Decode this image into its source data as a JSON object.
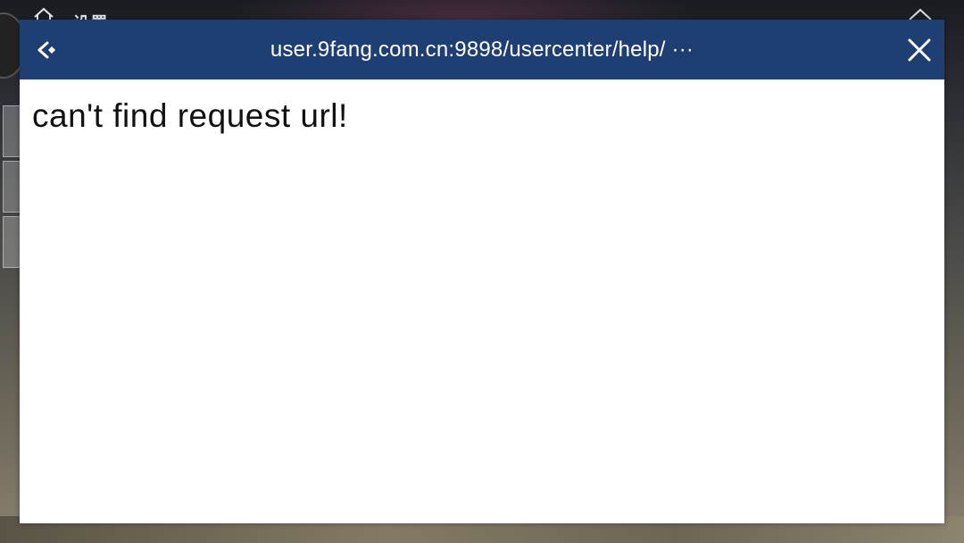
{
  "background": {
    "title": "设置",
    "icons": [
      "home-icon",
      "chevron-up-icon"
    ]
  },
  "webview": {
    "url": "user.9fang.com.cn:9898/usercenter/help/ ···",
    "back_icon": "back-arrow-icon",
    "close_icon": "close-icon",
    "header_color": "#1f3f72",
    "body_text": "can't find request url!"
  }
}
